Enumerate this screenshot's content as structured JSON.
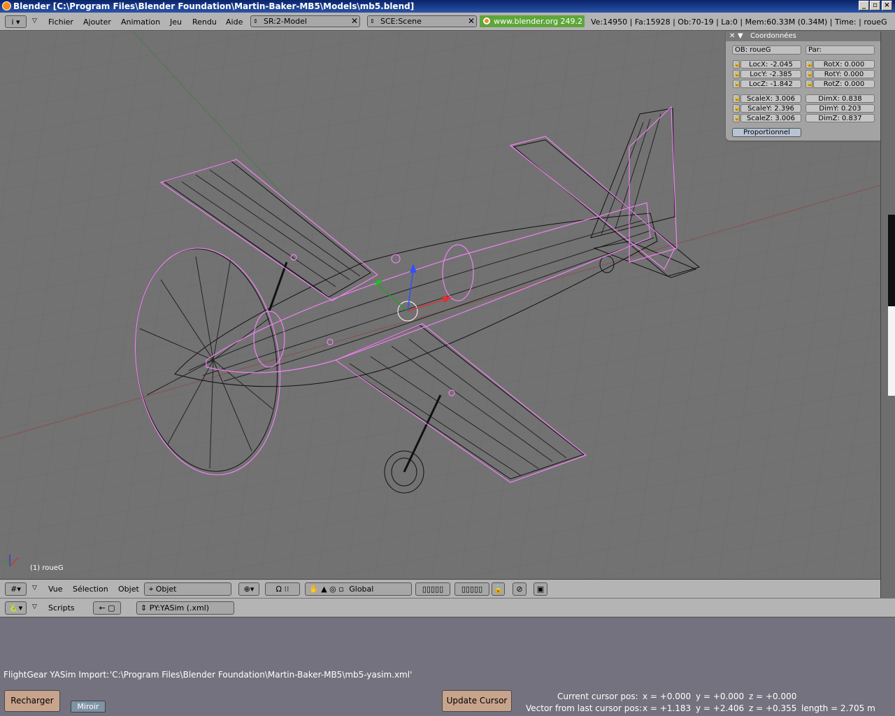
{
  "window": {
    "title": "Blender [C:\\Program Files\\Blender Foundation\\Martin-Baker-MB5\\Models\\mb5.blend]"
  },
  "top_header": {
    "menus": [
      "Fichier",
      "Ajouter",
      "Animation",
      "Jeu",
      "Rendu",
      "Aide"
    ],
    "screen": "SR:2-Model",
    "scene": "SCE:Scene",
    "url": "www.blender.org 249.2",
    "stats": "Ve:14950 | Fa:15928 | Ob:70-19 | La:0  | Mem:60.33M (0.34M)  | Time:  | roueG"
  },
  "viewport": {
    "object_label": "(1) roueG"
  },
  "transform_panel": {
    "title": "Coordonnées",
    "ob_field": "OB: roueG",
    "par_field": "Par:",
    "loc": [
      "LocX: -2.045",
      "LocY: -2.385",
      "LocZ: -1.842"
    ],
    "rot": [
      "RotX: 0.000",
      "RotY: 0.000",
      "RotZ: 0.000"
    ],
    "scale": [
      "ScaleX: 3.006",
      "ScaleY: 2.396",
      "ScaleZ: 3.006"
    ],
    "dim": [
      "DimX: 0.838",
      "DimY: 0.203",
      "DimZ: 0.837"
    ],
    "button": "Proportionnel"
  },
  "view3d_header": {
    "menus": [
      "Vue",
      "Sélection",
      "Objet"
    ],
    "mode": "Objet",
    "orientation": "Global"
  },
  "scripts_header": {
    "label": "Scripts",
    "script": "PY:YASim (.xml)"
  },
  "script_panel": {
    "import_label": "FlightGear YASim Import:",
    "import_path": "'C:\\Program Files\\Blender Foundation\\Martin-Baker-MB5\\mb5-yasim.xml'",
    "reload_button": "Recharger",
    "mirror_button": "Miroir",
    "update_button": "Update Cursor",
    "cursor_label": "Current cursor pos:",
    "cursor_x": "x = +0.000",
    "cursor_y": "y = +0.000",
    "cursor_z": "z = +0.000",
    "vector_label": "Vector from last cursor pos:",
    "vector_x": "x = +1.183",
    "vector_y": "y = +2.406",
    "vector_z": "z = +0.355",
    "vector_length": "length = 2.705 m"
  }
}
